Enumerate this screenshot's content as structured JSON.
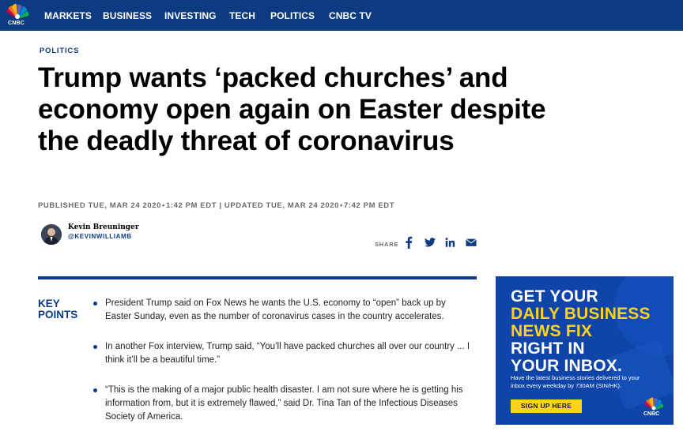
{
  "nav": {
    "logo_text": "CNBC",
    "items": [
      {
        "label": "MARKETS"
      },
      {
        "label": "BUSINESS"
      },
      {
        "label": "INVESTING"
      },
      {
        "label": "TECH"
      },
      {
        "label": "POLITICS"
      },
      {
        "label": "CNBC TV"
      }
    ]
  },
  "article": {
    "kicker": "POLITICS",
    "headline": "Trump wants ‘packed churches’ and economy open again on Easter despite the deadly threat of coronavirus",
    "published": "PUBLISHED TUE, MAR 24 2020",
    "published_time": "1:42 PM EDT",
    "updated": "UPDATED TUE, MAR 24 2020",
    "updated_time": "7:42 PM EDT",
    "separator": "|",
    "author": {
      "name": "Kevin Breuninger",
      "handle": "@KEVINWILLIAMB"
    },
    "share_label": "SHARE",
    "share_icons": [
      "facebook-icon",
      "twitter-icon",
      "linkedin-icon",
      "email-icon"
    ]
  },
  "key_points": {
    "title": "KEY POINTS",
    "items": [
      "President Trump said on Fox News he wants the U.S. economy to “open” back up by Easter Sunday, even as the number of coronavirus cases in the country accelerates.",
      "In another Fox interview, Trump said, “You’ll have packed churches all over our country ... I think it’ll be a beautiful time.”",
      "“This is the making of a major public health disaster. I am not sure where he is getting his information from, but it is extremely flawed,” said Dr. Tina Tan of the Infectious Diseases Society of America."
    ]
  },
  "ad": {
    "lines": [
      "GET YOUR",
      "DAILY BUSINESS",
      "NEWS FIX",
      "RIGHT IN",
      "YOUR INBOX."
    ],
    "body": "Have the latest business stories delivered to your inbox every weekday by 730AM (SIN/HK).",
    "cta": "SIGN UP HERE",
    "logo_text": "CNBC"
  },
  "colors": {
    "brand_blue": "#0d3b82",
    "ad_blue": "#0f45a8",
    "ad_yellow": "#ffd21e"
  }
}
